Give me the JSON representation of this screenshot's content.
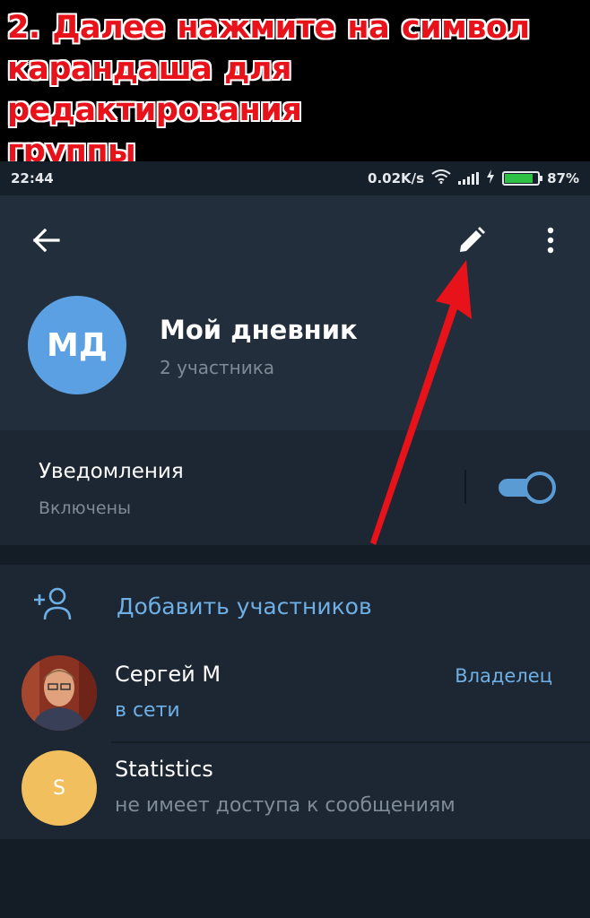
{
  "caption": {
    "lines": [
      "2. Далее нажмите на символ",
      "карандаша для редактирования",
      "группы"
    ]
  },
  "status_bar": {
    "time": "22:44",
    "speed": "0.02K/s",
    "battery_percent": "87%",
    "battery_level": 0.87
  },
  "toolbar": {
    "back_icon": "arrow-left-icon",
    "edit_icon": "pencil-icon",
    "more_icon": "more-vertical-icon"
  },
  "group": {
    "initials": "МД",
    "name": "Мой дневник",
    "members_count": "2 участника",
    "avatar_color": "#5aa0e2"
  },
  "notifications": {
    "title": "Уведомления",
    "status": "Включены",
    "enabled": true
  },
  "members": {
    "add_label": "Добавить участников",
    "list": [
      {
        "name": "Сергей М",
        "status": "в сети",
        "role": "Владелец"
      },
      {
        "name": "Statistics",
        "status": "не имеет доступа к сообщениям",
        "initial": "S",
        "avatar_color": "#f2bf5e"
      }
    ]
  },
  "colors": {
    "accent": "#6eb0e6",
    "background": "#1d2733",
    "header": "#222e3b",
    "annotation_arrow": "#e8121b"
  }
}
